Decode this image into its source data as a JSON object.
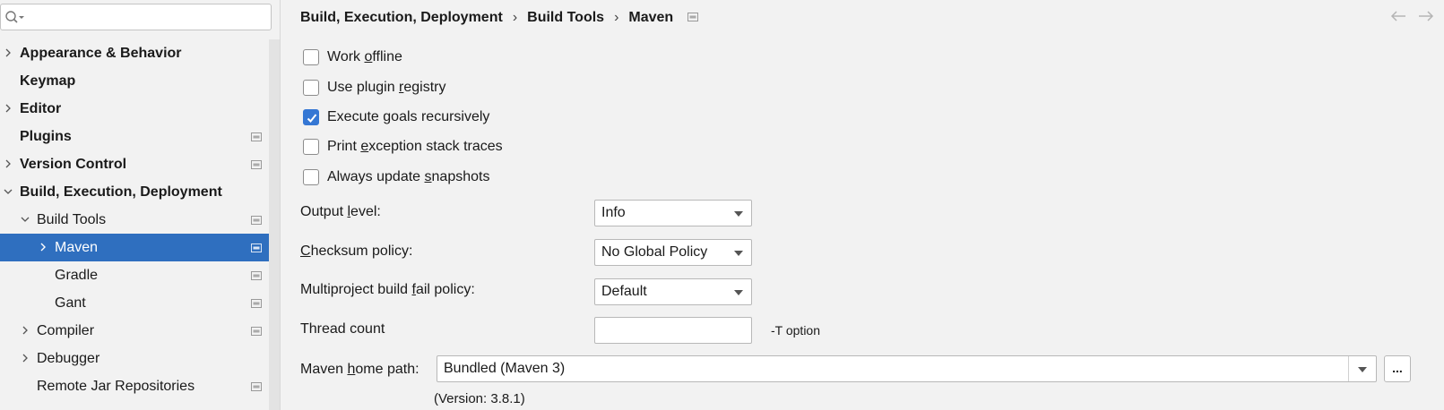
{
  "search": {
    "value": "",
    "placeholder": ""
  },
  "tree": [
    {
      "label": "Appearance & Behavior",
      "bold": true,
      "arrow": "right",
      "project": false
    },
    {
      "label": "Keymap",
      "bold": true,
      "arrow": "none",
      "project": false
    },
    {
      "label": "Editor",
      "bold": true,
      "arrow": "right",
      "project": false
    },
    {
      "label": "Plugins",
      "bold": true,
      "arrow": "none",
      "project": true
    },
    {
      "label": "Version Control",
      "bold": true,
      "arrow": "right",
      "project": true
    },
    {
      "label": "Build, Execution, Deployment",
      "bold": true,
      "arrow": "down",
      "project": false
    },
    {
      "label": "Build Tools",
      "bold": false,
      "arrow": "down",
      "project": true
    },
    {
      "label": "Maven",
      "bold": false,
      "arrow": "right",
      "project": true,
      "selected": true
    },
    {
      "label": "Gradle",
      "bold": false,
      "arrow": "none",
      "project": true
    },
    {
      "label": "Gant",
      "bold": false,
      "arrow": "none",
      "project": true
    },
    {
      "label": "Compiler",
      "bold": false,
      "arrow": "right",
      "project": true
    },
    {
      "label": "Debugger",
      "bold": false,
      "arrow": "right",
      "project": false
    },
    {
      "label": "Remote Jar Repositories",
      "bold": false,
      "arrow": "none",
      "project": true
    }
  ],
  "breadcrumb": {
    "items": [
      "Build, Execution, Deployment",
      "Build Tools",
      "Maven"
    ],
    "separator": "›"
  },
  "options": [
    {
      "pre": "Work ",
      "mnemonic": "o",
      "post": "ffline",
      "checked": false
    },
    {
      "pre": "Use plugin ",
      "mnemonic": "r",
      "post": "egistry",
      "checked": false
    },
    {
      "pre": "Execute ",
      "mnemonic": "g",
      "post": "oals recursively",
      "checked": true
    },
    {
      "pre": "Print ",
      "mnemonic": "e",
      "post": "xception stack traces",
      "checked": false
    },
    {
      "pre": "Always update ",
      "mnemonic": "s",
      "post": "napshots",
      "checked": false
    }
  ],
  "output_level": {
    "pre": "Output ",
    "mnemonic": "l",
    "post": "evel:",
    "value": "Info"
  },
  "checksum_policy": {
    "pre": "",
    "mnemonic": "C",
    "post": "hecksum policy:",
    "value": "No Global Policy"
  },
  "fail_policy": {
    "pre": "Multiproject build ",
    "mnemonic": "f",
    "post": "ail policy:",
    "value": "Default"
  },
  "thread_count": {
    "label": "Thread count",
    "value": "",
    "hint": "-T option"
  },
  "maven_home": {
    "pre": "Maven ",
    "mnemonic": "h",
    "post": "ome path:",
    "value": "Bundled (Maven 3)",
    "browse": "...",
    "version": "(Version: 3.8.1)"
  },
  "colors": {
    "selection": "#2f6fbf",
    "checkbox_checked": "#3577d4",
    "background": "#f2f2f2"
  }
}
